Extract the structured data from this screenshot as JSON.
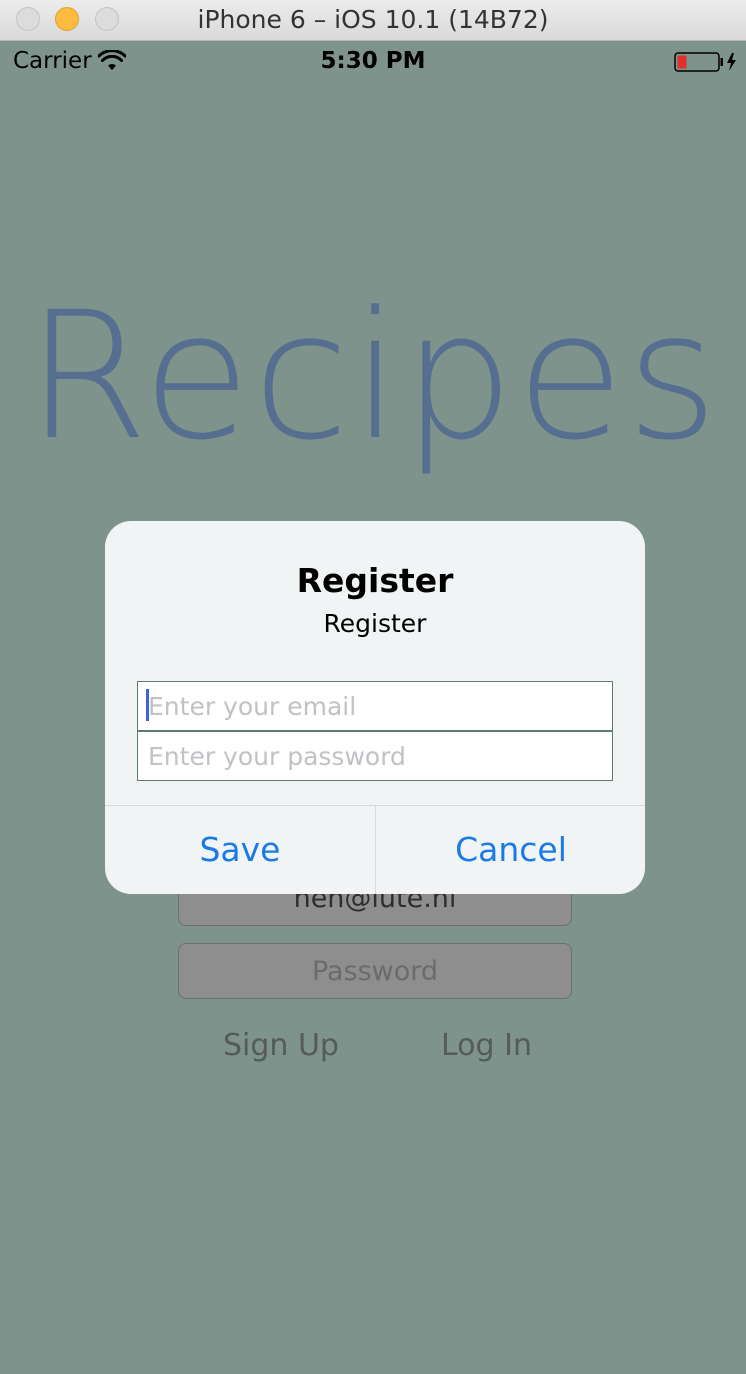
{
  "window": {
    "title": "iPhone 6 – iOS 10.1 (14B72)"
  },
  "status_bar": {
    "carrier": "Carrier",
    "time": "5:30 PM",
    "icons": [
      "wifi-icon",
      "battery-icon",
      "charging-bolt-icon"
    ]
  },
  "app": {
    "title": "Recipes",
    "email_value": "hen@lute.nl",
    "password_placeholder": "Password",
    "signup_label": "Sign Up",
    "login_label": "Log In"
  },
  "alert": {
    "title": "Register",
    "message": "Register",
    "email_placeholder": "Enter your email",
    "password_placeholder": "Enter your password",
    "save_label": "Save",
    "cancel_label": "Cancel"
  },
  "colors": {
    "background": "#7e938b",
    "app_title": "#566e8f",
    "alert_button": "#1a7ae6",
    "battery_low": "#e0302b"
  }
}
